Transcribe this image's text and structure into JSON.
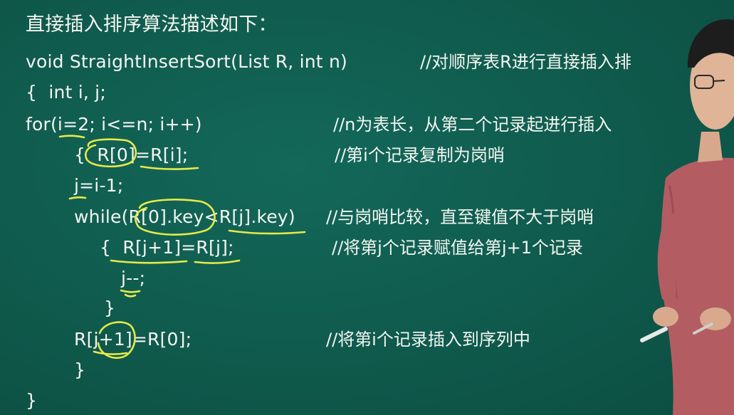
{
  "title": "直接插入排序算法描述如下：",
  "code": {
    "l1": "void StraightInsertSort(List R, int n)",
    "l2": "{  int i, j;",
    "l3": "for(i=2; i<=n; i++)",
    "l4": "{  R[0]=R[i];",
    "l5": "j=i-1;",
    "l6": "while(R[0].key<R[j].key)",
    "l7": "{  R[j+1]=R[j];",
    "l8": "j--;",
    "l9": "}",
    "l10": "R[j+1]=R[0];",
    "l11": "}",
    "l12": "}"
  },
  "comments": {
    "c1": "//对顺序表R进行直接插入排",
    "c3": "//n为表长，从第二个记录起进行插入",
    "c4": "//第i个记录复制为岗哨",
    "c6": "//与岗哨比较，直至键值不大于岗哨",
    "c7": "//将第j个记录赋值给第j+1个记录",
    "c10": "//将第i个记录插入到序列中"
  },
  "colors": {
    "board": "#0f5b4d",
    "chalk": "#f4f6f2",
    "highlighter": "#e6e94a"
  }
}
